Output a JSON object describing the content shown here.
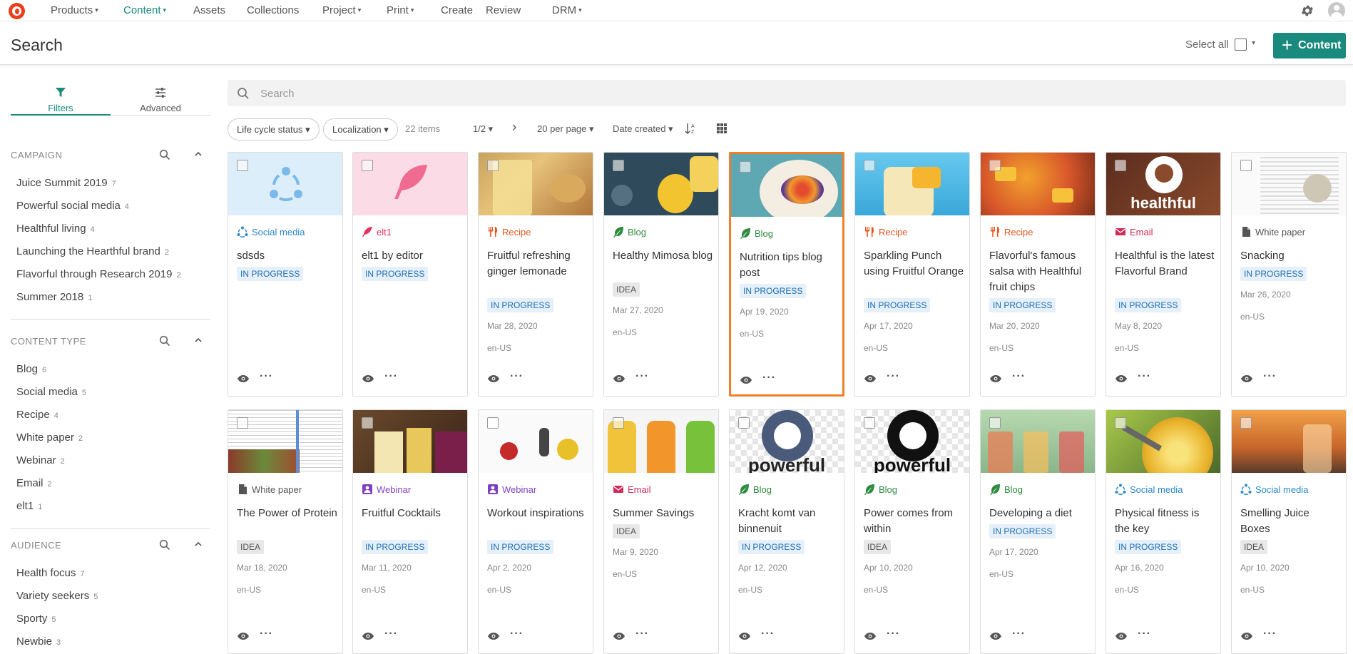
{
  "nav": {
    "items": [
      {
        "label": "Products",
        "caret": "▾"
      },
      {
        "label": "Content",
        "caret": "▾"
      },
      {
        "label": "Assets",
        "caret": ""
      },
      {
        "label": "Collections",
        "caret": ""
      },
      {
        "label": "Project",
        "caret": "▾"
      },
      {
        "label": "Print",
        "caret": "▾"
      },
      {
        "label": "Create",
        "caret": ""
      },
      {
        "label": "Review",
        "caret": ""
      },
      {
        "label": "DRM",
        "caret": "▾"
      }
    ],
    "active_index": 1
  },
  "header": {
    "title": "Search",
    "select_all": "Select all",
    "add_label": "Content"
  },
  "tabs": {
    "filters": "Filters",
    "advanced": "Advanced"
  },
  "filters": {
    "campaign": {
      "title": "CAMPAIGN",
      "items": [
        {
          "label": "Juice Summit 2019",
          "count": "7"
        },
        {
          "label": "Powerful social media",
          "count": "4"
        },
        {
          "label": "Healthful living",
          "count": "4"
        },
        {
          "label": "Launching the Hearthful brand",
          "count": "2"
        },
        {
          "label": "Flavorful through Research 2019",
          "count": "2"
        },
        {
          "label": "Summer 2018",
          "count": "1"
        }
      ]
    },
    "content_type": {
      "title": "CONTENT TYPE",
      "items": [
        {
          "label": "Blog",
          "count": "6"
        },
        {
          "label": "Social media",
          "count": "5"
        },
        {
          "label": "Recipe",
          "count": "4"
        },
        {
          "label": "White paper",
          "count": "2"
        },
        {
          "label": "Webinar",
          "count": "2"
        },
        {
          "label": "Email",
          "count": "2"
        },
        {
          "label": "elt1",
          "count": "1"
        }
      ]
    },
    "audience": {
      "title": "AUDIENCE",
      "items": [
        {
          "label": "Health focus",
          "count": "7"
        },
        {
          "label": "Variety seekers",
          "count": "5"
        },
        {
          "label": "Sporty",
          "count": "5"
        },
        {
          "label": "Newbie",
          "count": "3"
        }
      ]
    }
  },
  "search": {
    "placeholder": "Search"
  },
  "toolbar": {
    "lifecycle": "Life cycle status ▾",
    "localization": "Localization ▾",
    "items": "22 items",
    "page": "1/2 ▾",
    "next": "›",
    "per_page": "20 per page ▾",
    "sort": "Date created ▾"
  },
  "colors": {
    "accent": "#1a8a7e",
    "social": "#2b87c9",
    "recipe": "#e4571f",
    "blog": "#2e8b3e",
    "email": "#d12a58",
    "webinar": "#7f3fbf",
    "whitepaper": "#555555",
    "elt1": "#e0335e",
    "selected_border": "#f07f27"
  },
  "cards": [
    {
      "type": "Social media",
      "icon": "social-icon",
      "title": "sdsds",
      "status": "IN PROGRESS",
      "date": "",
      "locale": "",
      "thumb": "social"
    },
    {
      "type": "elt1",
      "icon": "feather-icon",
      "title": "elt1 by editor",
      "status": "IN PROGRESS",
      "date": "",
      "locale": "",
      "thumb": "feather"
    },
    {
      "type": "Recipe",
      "icon": "utensils-icon",
      "title": "Fruitful refreshing ginger lemonade",
      "status": "IN PROGRESS",
      "date": "Mar 28, 2020",
      "locale": "en-US",
      "thumb": "lemonade"
    },
    {
      "type": "Blog",
      "icon": "leaf-icon",
      "title": "Healthy Mimosa blog",
      "status": "IDEA",
      "date": "Mar 27, 2020",
      "locale": "en-US",
      "thumb": "mimosa"
    },
    {
      "type": "Blog",
      "icon": "leaf-icon",
      "title": "Nutrition tips blog post",
      "status": "IN PROGRESS",
      "date": "Apr 19, 2020",
      "locale": "en-US",
      "thumb": "bowl",
      "selected": true
    },
    {
      "type": "Recipe",
      "icon": "utensils-icon",
      "title": "Sparkling Punch using Fruitful Orange",
      "status": "IN PROGRESS",
      "date": "Apr 17, 2020",
      "locale": "en-US",
      "thumb": "punch"
    },
    {
      "type": "Recipe",
      "icon": "utensils-icon",
      "title": "Flavorful's famous salsa with Healthful fruit chips",
      "status": "IN PROGRESS",
      "date": "Mar 20, 2020",
      "locale": "en-US",
      "thumb": "salsa"
    },
    {
      "type": "Email",
      "icon": "mail-icon",
      "title": "Healthful is the latest Flavorful Brand",
      "status": "IN PROGRESS",
      "date": "May 8, 2020",
      "locale": "en-US",
      "thumb": "healthful",
      "thumb_text": "healthful"
    },
    {
      "type": "White paper",
      "icon": "document-icon",
      "title": "Snacking",
      "status": "IN PROGRESS",
      "date": "Mar 26, 2020",
      "locale": "en-US",
      "thumb": "paper"
    },
    {
      "type": "White paper",
      "icon": "document-icon",
      "title": "The Power of Protein",
      "status": "IDEA",
      "date": "Mar 18, 2020",
      "locale": "en-US",
      "thumb": "protein"
    },
    {
      "type": "Webinar",
      "icon": "webinar-icon",
      "title": "Fruitful Cocktails",
      "status": "IN PROGRESS",
      "date": "Mar 11, 2020",
      "locale": "en-US",
      "thumb": "cocktails"
    },
    {
      "type": "Webinar",
      "icon": "webinar-icon",
      "title": "Workout inspirations",
      "status": "IN PROGRESS",
      "date": "Apr 2, 2020",
      "locale": "en-US",
      "thumb": "workout"
    },
    {
      "type": "Email",
      "icon": "mail-icon",
      "title": "Summer Savings",
      "status": "IDEA",
      "date": "Mar 9, 2020",
      "locale": "en-US",
      "thumb": "bottles"
    },
    {
      "type": "Blog",
      "icon": "leaf-icon",
      "title": "Kracht komt van binnenuit",
      "status": "IN PROGRESS",
      "date": "Apr 12, 2020",
      "locale": "en-US",
      "thumb": "powerful_blue",
      "thumb_text": "powerful"
    },
    {
      "type": "Blog",
      "icon": "leaf-icon",
      "title": "Power comes from within",
      "status": "IDEA",
      "date": "Apr 10, 2020",
      "locale": "en-US",
      "thumb": "powerful_black",
      "thumb_text": "powerful"
    },
    {
      "type": "Blog",
      "icon": "leaf-icon",
      "title": "Developing a diet",
      "status": "IN PROGRESS",
      "date": "Apr 17, 2020",
      "locale": "en-US",
      "thumb": "jars"
    },
    {
      "type": "Social media",
      "icon": "social-icon",
      "title": "Physical fitness is the key",
      "status": "IN PROGRESS",
      "date": "Apr 16, 2020",
      "locale": "en-US",
      "thumb": "pineapple"
    },
    {
      "type": "Social media",
      "icon": "social-icon",
      "title": "Smelling Juice Boxes",
      "status": "IDEA",
      "date": "Apr 10, 2020",
      "locale": "en-US",
      "thumb": "sunset"
    }
  ]
}
